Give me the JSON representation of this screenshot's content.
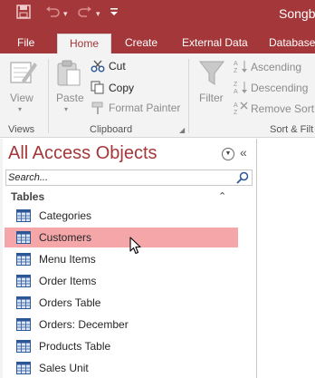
{
  "app": {
    "title": "Songbir"
  },
  "quick_access": {
    "save_icon": "save-icon",
    "undo_icon": "undo-icon",
    "redo_icon": "redo-icon",
    "customize_icon": "customize-toolbar-icon"
  },
  "tabs": [
    {
      "label": "File"
    },
    {
      "label": "Home"
    },
    {
      "label": "Create"
    },
    {
      "label": "External Data"
    },
    {
      "label": "Database"
    }
  ],
  "ribbon": {
    "views": {
      "view_label": "View",
      "group_label": "Views"
    },
    "clipboard": {
      "paste_label": "Paste",
      "cut_label": "Cut",
      "copy_label": "Copy",
      "format_painter_label": "Format Painter",
      "group_label": "Clipboard"
    },
    "sort_filter": {
      "filter_label": "Filter",
      "ascending_label": "Ascending",
      "descending_label": "Descending",
      "remove_sort_label": "Remove Sort",
      "group_label": "Sort & Filt"
    }
  },
  "nav": {
    "title": "All Access Objects",
    "search_placeholder": "Search...",
    "section_label": "Tables",
    "items": [
      {
        "label": "Categories"
      },
      {
        "label": "Customers"
      },
      {
        "label": "Menu Items"
      },
      {
        "label": "Order Items"
      },
      {
        "label": "Orders Table"
      },
      {
        "label": "Orders: December"
      },
      {
        "label": "Products Table"
      },
      {
        "label": "Sales Unit"
      }
    ],
    "selected_label": "Customers"
  },
  "colors": {
    "brand": "#a4373a",
    "selected_row": "#f4a6a8",
    "ribbon_bg": "#f3f3f3"
  }
}
